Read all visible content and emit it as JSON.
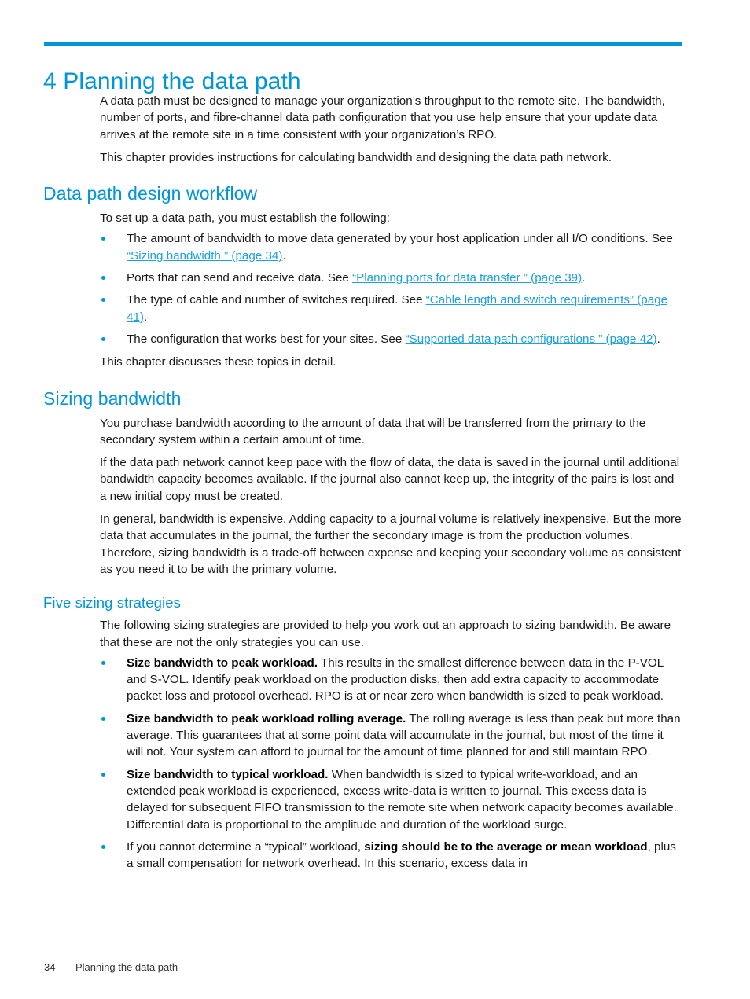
{
  "document": {
    "chapter_title": "4 Planning the data path",
    "accent_color": "#0096d6",
    "link_color": "#1ba1dc"
  },
  "intro": {
    "paragraph_1": "A data path must be designed to manage your organization’s throughput to the remote site. The bandwidth, number of ports, and fibre-channel data path configuration that you use help ensure that your update data arrives at the remote site in a time consistent with your organization’s RPO.",
    "paragraph_2": "This chapter provides instructions for calculating bandwidth and designing the data path network."
  },
  "workflow": {
    "heading": "Data path design workflow",
    "intro": "To set up a data path, you must establish the following:",
    "bullets": [
      {
        "text_before": "The amount of bandwidth to move data generated by your host application under all I/O conditions. See ",
        "link": "“Sizing bandwidth ” (page 34)",
        "text_after": "."
      },
      {
        "text_before": "Ports that can send and receive data. See ",
        "link": "“Planning ports for data transfer ” (page 39)",
        "text_after": "."
      },
      {
        "text_before": "The type of cable and number of switches required. See ",
        "link": "“Cable length and switch requirements” (page 41)",
        "text_after": "."
      },
      {
        "text_before": "The configuration that works best for your sites. See ",
        "link": "“Supported data path configurations ” (page 42)",
        "text_after": "."
      }
    ],
    "closing": "This chapter discusses these topics in detail."
  },
  "sizing": {
    "heading": "Sizing bandwidth",
    "paragraph_1": "You purchase bandwidth according to the amount of data that will be transferred from the primary to the secondary system within a certain amount of time.",
    "paragraph_2": "If the data path network cannot keep pace with the flow of data, the data is saved in the journal until additional bandwidth capacity becomes available. If the journal also cannot keep up, the integrity of the pairs is lost and a new initial copy must be created.",
    "paragraph_3": "In general, bandwidth is expensive. Adding capacity to a journal volume is relatively inexpensive. But the more data that accumulates in the journal, the further the secondary image is from the production volumes. Therefore, sizing bandwidth is a trade-off between expense and keeping your secondary volume as consistent as you need it to be with the primary volume."
  },
  "strategies": {
    "heading": "Five sizing strategies",
    "intro": "The following sizing strategies are provided to help you work out an approach to sizing bandwidth. Be aware that these are not the only strategies you can use.",
    "bullets": [
      {
        "lead_bold": "Size bandwidth to peak workload.",
        "body": " This results in the smallest difference between data in the P-VOL and S-VOL. Identify peak workload on the production disks, then add extra capacity to accommodate packet loss and protocol overhead. RPO is at or near zero when bandwidth is sized to peak workload."
      },
      {
        "lead_bold": "Size bandwidth to peak workload rolling average.",
        "body": " The rolling average is less than peak but more than average. This guarantees that at some point data will accumulate in the journal, but most of the time it will not. Your system can afford to journal for the amount of time planned for and still maintain RPO."
      },
      {
        "lead_bold": "Size bandwidth to typical workload.",
        "body": " When bandwidth is sized to typical write-workload, and an extended peak workload is experienced, excess write-data is written to journal. This excess data is delayed for subsequent FIFO transmission to the remote site when network capacity becomes available. Differential data is proportional to the amplitude and duration of the workload surge."
      },
      {
        "text_before": "If you cannot determine a “typical” workload, ",
        "bold_mid": "sizing should be to the average or mean workload",
        "text_after": ", plus a small compensation for network overhead. In this scenario, excess data in"
      }
    ]
  },
  "footer": {
    "page_number": "34",
    "running_title": "Planning the data path"
  }
}
